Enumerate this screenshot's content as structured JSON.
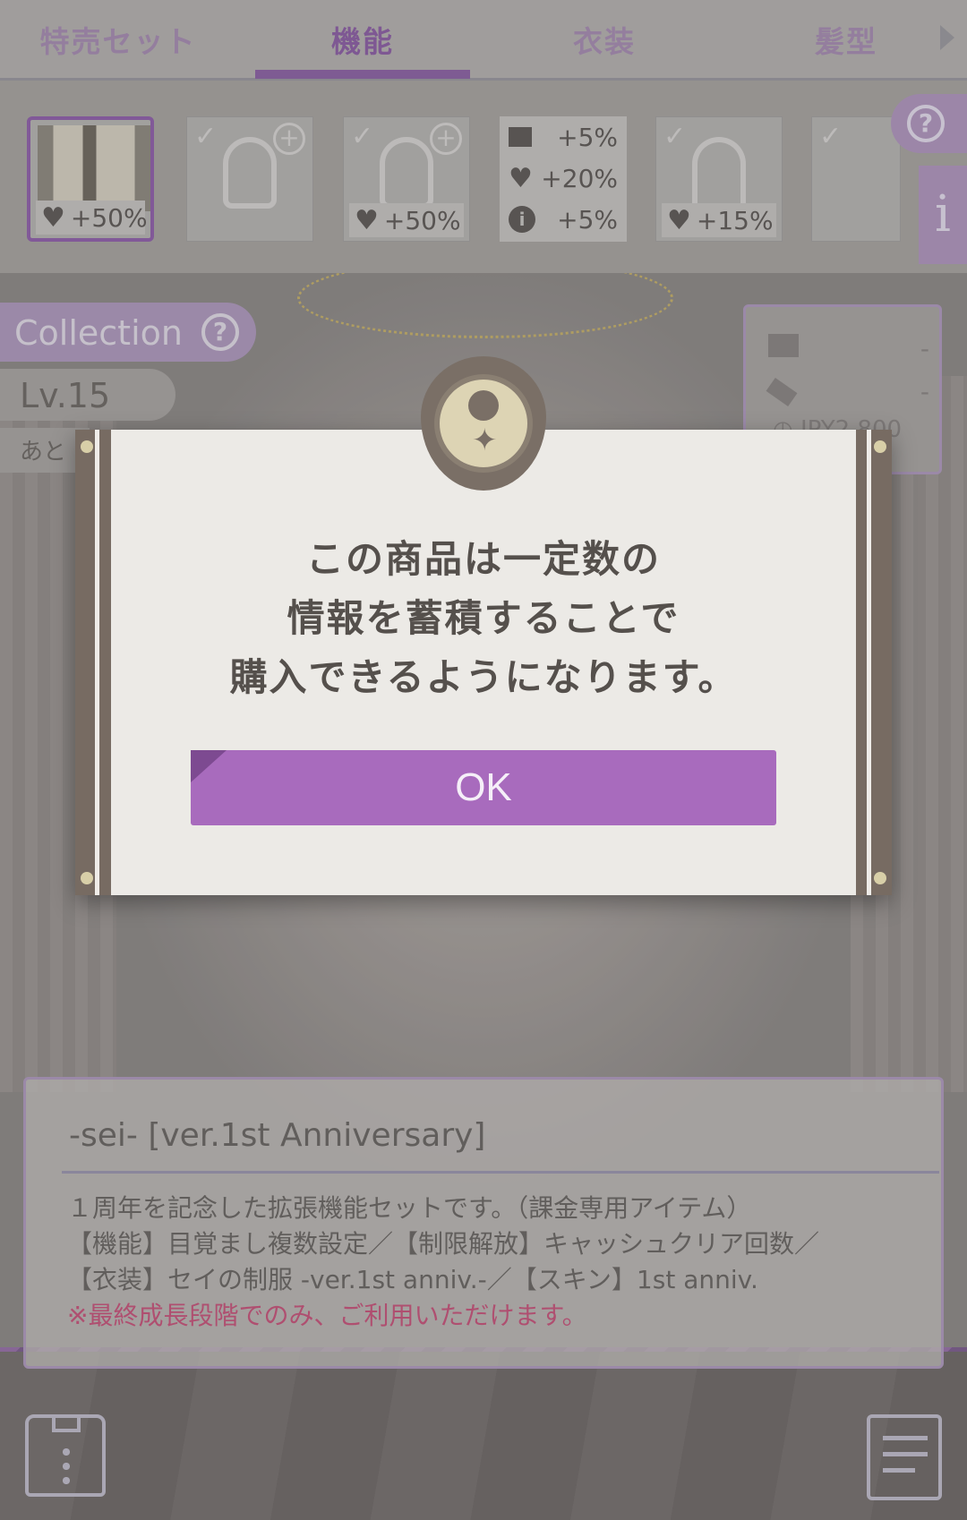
{
  "tabs": [
    {
      "label": "特売セット",
      "active": false
    },
    {
      "label": "機能",
      "active": true
    },
    {
      "label": "衣装",
      "active": false
    },
    {
      "label": "髪型",
      "active": false
    }
  ],
  "items": [
    {
      "type": "shirt",
      "bonus": "+50%",
      "selected": true,
      "checked": false
    },
    {
      "type": "mic-plus",
      "bonus": "",
      "selected": false,
      "checked": true
    },
    {
      "type": "mic-plus",
      "bonus": "+50%",
      "selected": false,
      "checked": true
    },
    {
      "type": "multi",
      "lines": [
        {
          "icon": "card-icon",
          "value": "+5%"
        },
        {
          "icon": "heart-icon",
          "value": "+20%"
        },
        {
          "icon": "info-icon",
          "value": "+5%"
        }
      ]
    },
    {
      "type": "headphones",
      "bonus": "+15%",
      "selected": false,
      "checked": true
    }
  ],
  "collection": {
    "label": "Collection"
  },
  "level": {
    "label": "Lv.15"
  },
  "ato": {
    "label": "あと"
  },
  "stats": {
    "rows": [
      "-",
      "-"
    ],
    "price": "JPY2,800"
  },
  "modal": {
    "line1": "この商品は一定数の",
    "line2": "情報を蓄積することで",
    "line3": "購入できるようになります。",
    "ok_label": "OK"
  },
  "description": {
    "title": "-sei- [ver.1st Anniversary]",
    "line1": "１周年を記念した拡張機能セットです。（課金専用アイテム）",
    "line2": "【機能】目覚まし複数設定／【制限解放】キャッシュクリア回数／",
    "line3": "【衣装】セイの制服 -ver.1st anniv.-／【スキン】1st anniv.",
    "warning": "※最終成長段階でのみ、ご利用いただけます。"
  },
  "colors": {
    "accent": "#a86bbd",
    "warning": "#c9537c"
  }
}
